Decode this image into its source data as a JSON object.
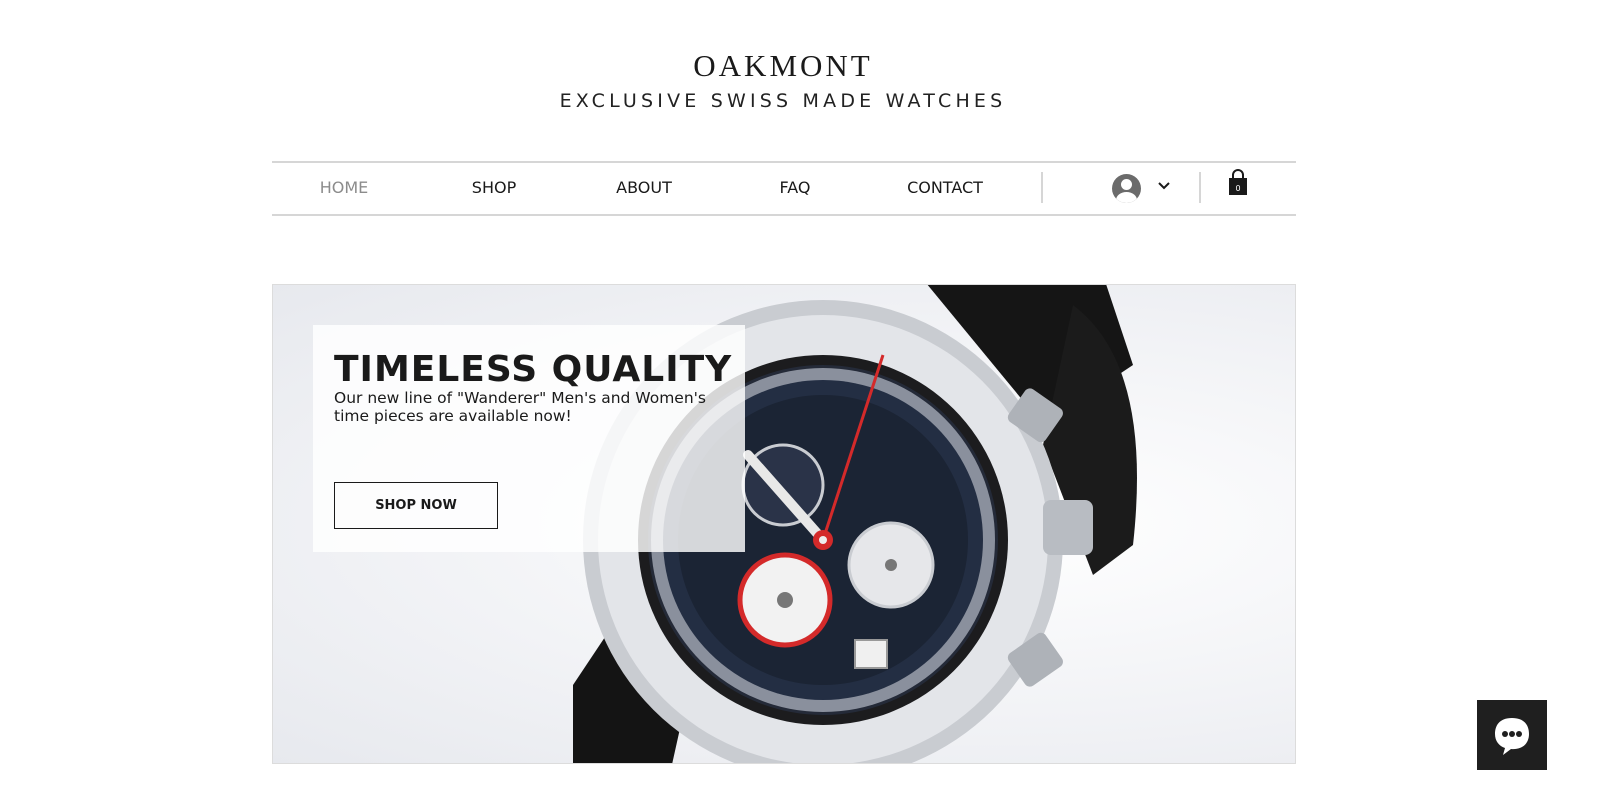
{
  "brand": {
    "name": "OAKMONT",
    "tagline": "EXCLUSIVE SWISS MADE WATCHES"
  },
  "nav": {
    "items": [
      {
        "label": "HOME",
        "active": true
      },
      {
        "label": "SHOP",
        "active": false
      },
      {
        "label": "ABOUT",
        "active": false
      },
      {
        "label": "FAQ",
        "active": false
      },
      {
        "label": "CONTACT",
        "active": false
      }
    ],
    "account_icon": "user-avatar-icon",
    "dropdown_icon": "chevron-down-icon",
    "cart_icon": "shopping-bag-icon",
    "cart_count": "0"
  },
  "hero": {
    "title": "TIMELESS QUALITY",
    "subtitle": "Our new line of \"Wanderer\" Men's and Women's time pieces are available now!",
    "button_label": "SHOP NOW"
  },
  "chat": {
    "icon": "chat-bubble-icon"
  },
  "colors": {
    "text": "#1a1a1a",
    "nav_active": "#8c8c8c",
    "divider": "#d6d6d6",
    "accent_red": "#d42a2a",
    "dial_blue": "#1b2434"
  }
}
